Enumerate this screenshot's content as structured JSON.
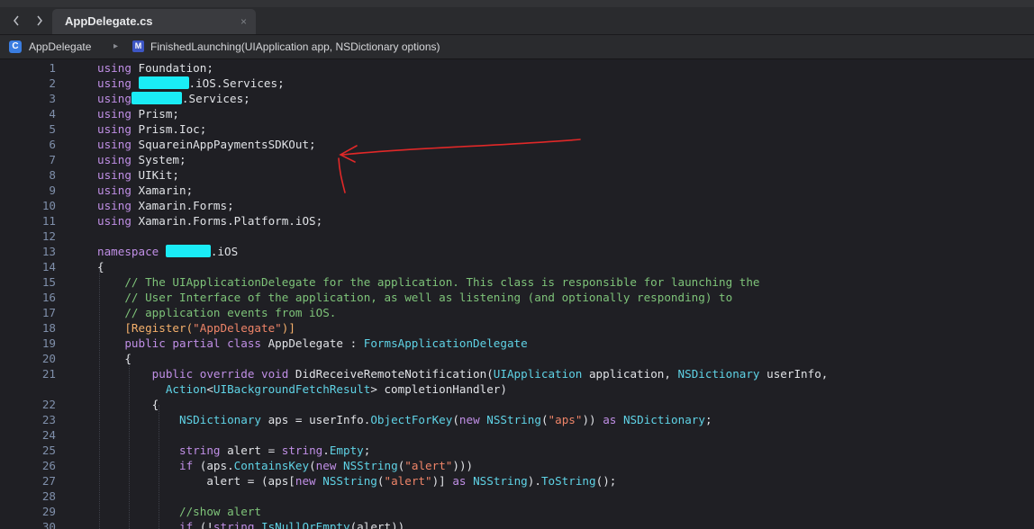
{
  "tabbar": {
    "back_icon": "chevron-left",
    "forward_icon": "chevron-right",
    "active_tab": "AppDelegate.cs",
    "close_icon": "×"
  },
  "jumpbar": {
    "class_icon": "C",
    "class_name": "AppDelegate",
    "separator": "▸",
    "method_icon": "M",
    "method_signature": "FinishedLaunching(UIApplication app, NSDictionary options)"
  },
  "colors": {
    "keyword": "#c08fe6",
    "type": "#5fd3e6",
    "comment": "#7ec379",
    "string": "#ee8468",
    "redaction": "#1aecf6",
    "annotation": "#e02828"
  },
  "code": {
    "lines": [
      {
        "n": "1",
        "c": "<span class='kw'>using</span> Foundation;"
      },
      {
        "n": "2",
        "c": "<span class='kw'>using</span> <span class='redact' style='width:56px'></span>.iOS.Services;"
      },
      {
        "n": "3",
        "c": "<span class='kw'>using</span><span class='redact' style='width:56px'></span>.Services;"
      },
      {
        "n": "4",
        "c": "<span class='kw'>using</span> Prism;"
      },
      {
        "n": "5",
        "c": "<span class='kw'>using</span> Prism.Ioc;"
      },
      {
        "n": "6",
        "c": "<span class='kw'>using</span> SquareinAppPaymentsSDKOut;"
      },
      {
        "n": "7",
        "c": "<span class='kw'>using</span> System;"
      },
      {
        "n": "8",
        "c": "<span class='kw'>using</span> UIKit;"
      },
      {
        "n": "9",
        "c": "<span class='kw'>using</span> Xamarin;"
      },
      {
        "n": "10",
        "c": "<span class='kw'>using</span> Xamarin.Forms;"
      },
      {
        "n": "11",
        "c": "<span class='kw'>using</span> Xamarin.Forms.Platform.iOS;"
      },
      {
        "n": "12",
        "c": ""
      },
      {
        "n": "13",
        "c": "<span class='kw'>namespace</span> <span class='redact' style='width:50px'></span>.iOS"
      },
      {
        "n": "14",
        "c": "{"
      },
      {
        "n": "15",
        "c": "    <span class='cm'>// The UIApplicationDelegate for the application. This class is responsible for launching the</span>"
      },
      {
        "n": "16",
        "c": "    <span class='cm'>// User Interface of the application, as well as listening (and optionally responding) to</span>"
      },
      {
        "n": "17",
        "c": "    <span class='cm'>// application events from iOS.</span>"
      },
      {
        "n": "18",
        "c": "    <span class='at'>[Register(</span><span class='st'>\"AppDelegate\"</span><span class='at'>)]</span>"
      },
      {
        "n": "19",
        "c": "    <span class='kw'>public partial class</span> AppDelegate : <span class='ty'>FormsApplicationDelegate</span>"
      },
      {
        "n": "20",
        "c": "    {"
      },
      {
        "n": "21",
        "c": "        <span class='kw'>public override void</span> DidReceiveRemoteNotification(<span class='ty'>UIApplication</span> application, <span class='ty'>NSDictionary</span> userInfo,"
      },
      {
        "n": "",
        "c": "          <span class='ty'>Action</span>&lt;<span class='ty'>UIBackgroundFetchResult</span>&gt; completionHandler)"
      },
      {
        "n": "22",
        "c": "        {"
      },
      {
        "n": "23",
        "c": "            <span class='ty'>NSDictionary</span> aps = userInfo.<span class='ty'>ObjectForKey</span>(<span class='kw'>new</span> <span class='ty'>NSString</span>(<span class='st'>\"aps\"</span>)) <span class='kw'>as</span> <span class='ty'>NSDictionary</span>;"
      },
      {
        "n": "24",
        "c": ""
      },
      {
        "n": "25",
        "c": "            <span class='kw'>string</span> alert = <span class='kw'>string</span>.<span class='ty'>Empty</span>;"
      },
      {
        "n": "26",
        "c": "            <span class='kw'>if</span> (aps.<span class='ty'>ContainsKey</span>(<span class='kw'>new</span> <span class='ty'>NSString</span>(<span class='st'>\"alert\"</span>)))"
      },
      {
        "n": "27",
        "c": "                alert = (aps[<span class='kw'>new</span> <span class='ty'>NSString</span>(<span class='st'>\"alert\"</span>)] <span class='kw'>as</span> <span class='ty'>NSString</span>).<span class='ty'>ToString</span>();"
      },
      {
        "n": "28",
        "c": ""
      },
      {
        "n": "29",
        "c": "            <span class='cm'>//show alert</span>"
      },
      {
        "n": "30",
        "c": "            <span class='kw'>if</span> (!<span class='kw'>string</span>.<span class='ty'>IsNullOrEmpty</span>(alert))"
      }
    ]
  }
}
